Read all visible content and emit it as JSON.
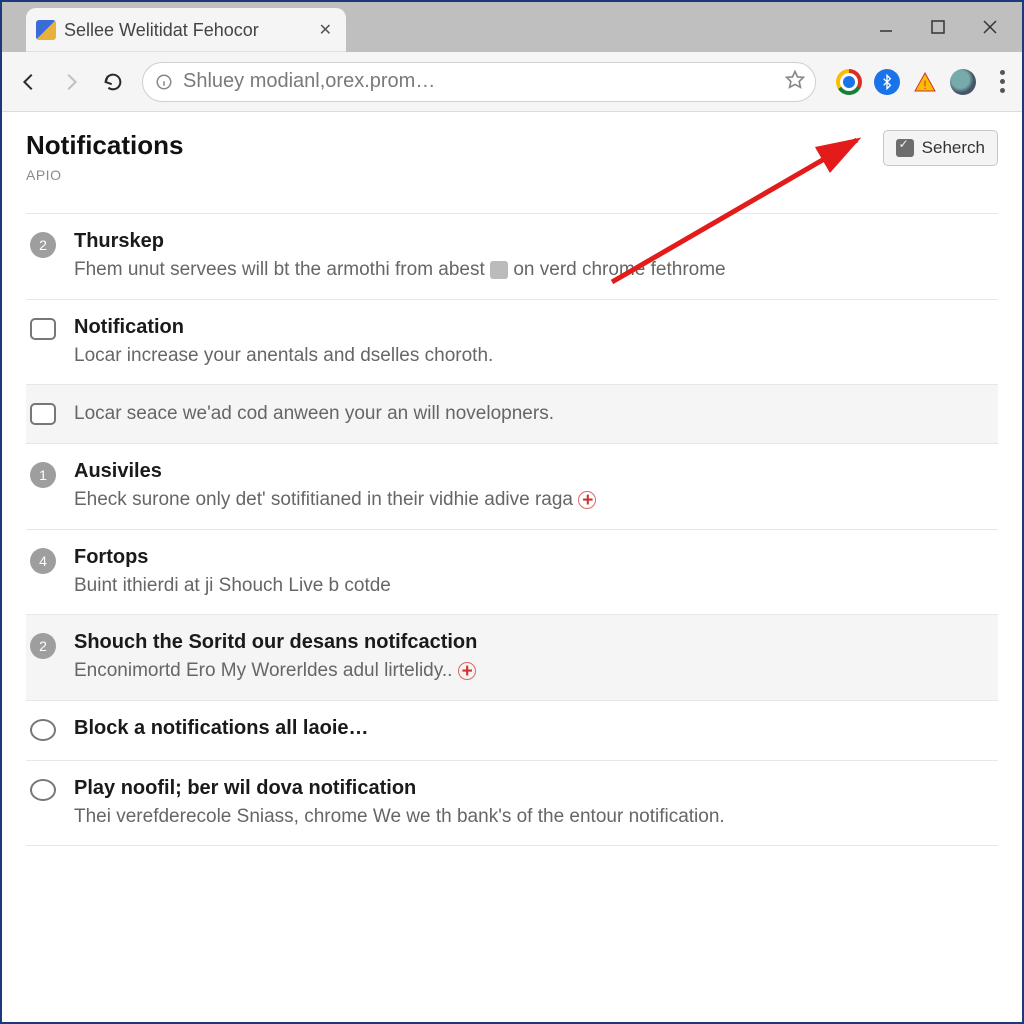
{
  "window": {
    "tab_title": "Sellee Welitidat Fehocor",
    "url_display": "Shluey modianl,orex.prom…"
  },
  "page": {
    "title": "Notifications",
    "subtitle": "APIO",
    "search_button_label": "Seherch"
  },
  "rows": [
    {
      "lead_type": "badge",
      "lead_value": "2",
      "shaded": false,
      "title": "Thurskep",
      "desc_before": "Fhem unut servees will bt the armothi from abest ",
      "inline_icon": "gray",
      "desc_after": " on verd chrome fethrome"
    },
    {
      "lead_type": "checkbox",
      "lead_value": "",
      "shaded": false,
      "title": "Notification",
      "desc_before": "Locar increase your anentals and dselles choroth.",
      "inline_icon": null,
      "desc_after": ""
    },
    {
      "lead_type": "checkbox",
      "lead_value": "",
      "shaded": true,
      "title": "",
      "desc_before": "Locar seace we'ad cod anween your an will novelopners.",
      "inline_icon": null,
      "desc_after": ""
    },
    {
      "lead_type": "badge",
      "lead_value": "1",
      "shaded": false,
      "title": "Ausiviles",
      "desc_before": "Eheck surone only det' sotifitianed in their vidhie adive raga ",
      "inline_icon": "redplus",
      "desc_after": ""
    },
    {
      "lead_type": "badge",
      "lead_value": "4",
      "shaded": false,
      "title": "Fortops",
      "desc_before": "Buint ithierdi at ji Shouch Live b cotde",
      "inline_icon": null,
      "desc_after": ""
    },
    {
      "lead_type": "badge",
      "lead_value": "2",
      "shaded": true,
      "title": "Shouch the Soritd our desans notifcaction",
      "desc_before": "Enconimortd Ero My Worerldes adul lirtelidy.. ",
      "inline_icon": "redplus",
      "desc_after": ""
    },
    {
      "lead_type": "radio",
      "lead_value": "",
      "shaded": false,
      "title": "Block a notifications all laoie…",
      "desc_before": "",
      "inline_icon": null,
      "desc_after": ""
    },
    {
      "lead_type": "radio",
      "lead_value": "",
      "shaded": false,
      "title": "Play noofil; ber wil dova notification",
      "desc_before": "Thei verefderecole Sniass, chrome We we th bank's of the entour notification.",
      "inline_icon": null,
      "desc_after": ""
    }
  ]
}
